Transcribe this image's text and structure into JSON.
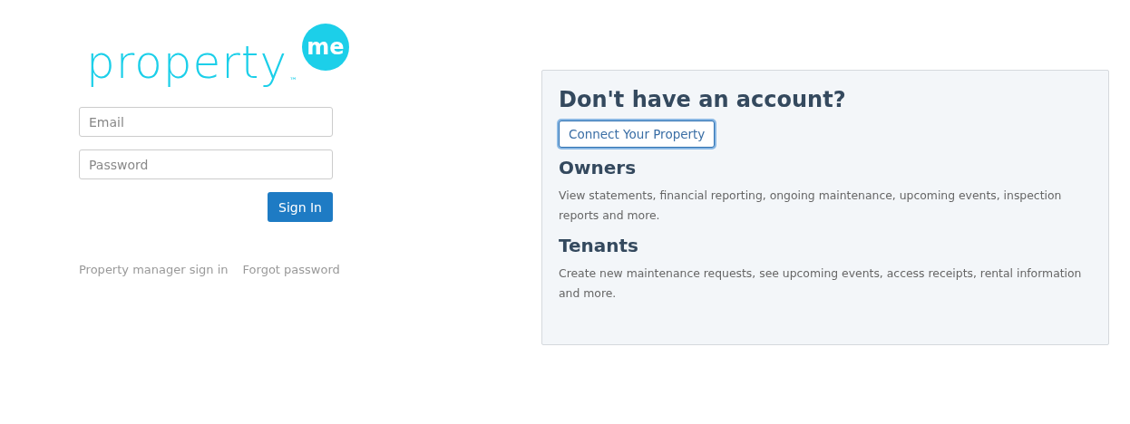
{
  "logo": {
    "wordmark": "property",
    "badge": "me",
    "trademark": "™"
  },
  "login_form": {
    "fields": [
      {
        "placeholder": "Email"
      },
      {
        "placeholder": "Password"
      }
    ],
    "submit": "Sign In",
    "links": [
      "Property manager sign in",
      "Forgot password"
    ]
  },
  "signup_panel": {
    "title": "Don't have an account?",
    "button": {
      "label": "Connect Your Property",
      "focused": true
    },
    "sections": [
      {
        "heading": "Owners",
        "text": "View statements, financial reporting, ongoing maintenance, upcoming events, inspection reports and more."
      },
      {
        "heading": "Tenants",
        "text": "Create new maintenance requests, see upcoming events, access receipts, rental information and more."
      }
    ]
  }
}
